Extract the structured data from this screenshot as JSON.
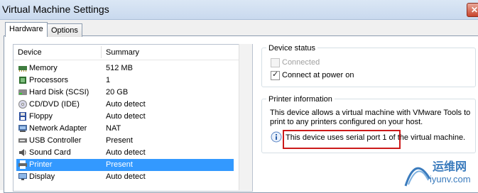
{
  "window": {
    "title": "Virtual Machine Settings",
    "close_glyph": "✕"
  },
  "tabs": [
    {
      "label": "Hardware",
      "active": true
    },
    {
      "label": "Options",
      "active": false
    }
  ],
  "device_list": {
    "columns": [
      "Device",
      "Summary"
    ],
    "rows": [
      {
        "device": "Memory",
        "summary": "512 MB",
        "icon": "memory-icon"
      },
      {
        "device": "Processors",
        "summary": "1",
        "icon": "processor-icon"
      },
      {
        "device": "Hard Disk (SCSI)",
        "summary": "20 GB",
        "icon": "hard-disk-icon"
      },
      {
        "device": "CD/DVD (IDE)",
        "summary": "Auto detect",
        "icon": "cd-dvd-icon"
      },
      {
        "device": "Floppy",
        "summary": "Auto detect",
        "icon": "floppy-icon"
      },
      {
        "device": "Network Adapter",
        "summary": "NAT",
        "icon": "network-adapter-icon"
      },
      {
        "device": "USB Controller",
        "summary": "Present",
        "icon": "usb-icon"
      },
      {
        "device": "Sound Card",
        "summary": "Auto detect",
        "icon": "sound-card-icon"
      },
      {
        "device": "Printer",
        "summary": "Present",
        "icon": "printer-icon",
        "selected": true
      },
      {
        "device": "Display",
        "summary": "Auto detect",
        "icon": "display-icon"
      }
    ]
  },
  "device_status": {
    "label": "Device status",
    "connected": {
      "label": "Connected",
      "checked": false,
      "enabled": false
    },
    "connect_at_power_on": {
      "label": "Connect at power on",
      "checked": true,
      "enabled": true
    }
  },
  "printer_info": {
    "label": "Printer information",
    "description": "This device allows a virtual machine with VMware Tools to print to any printers configured on your host.",
    "note": "This device uses serial port 1 of the virtual machine.",
    "info_icon": "info-icon",
    "highlight_color": "#cc1a1a"
  },
  "watermark": {
    "brand_cn": "运维网",
    "site": "iyunv.com",
    "color": "#3a7bbd"
  },
  "colors": {
    "selection": "#3399ff",
    "titlebar": "#c9d9ee"
  }
}
